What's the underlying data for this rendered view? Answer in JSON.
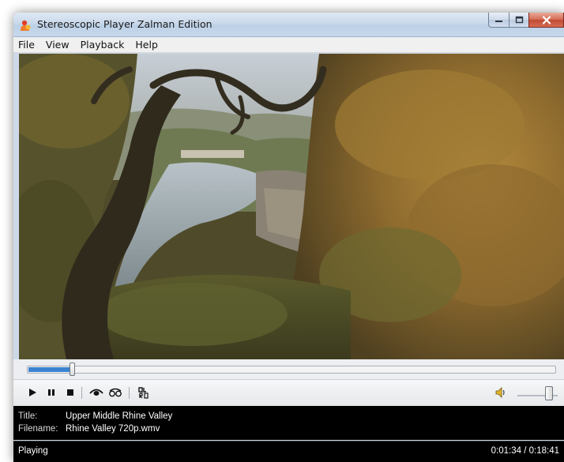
{
  "window": {
    "title": "Stereoscopic Player Zalman Edition"
  },
  "menu": [
    {
      "label": "File"
    },
    {
      "label": "View"
    },
    {
      "label": "Playback"
    },
    {
      "label": "Help"
    }
  ],
  "playback": {
    "position_fraction": 0.085,
    "volume_fraction": 0.85
  },
  "info": {
    "title_label": "Title:",
    "title_value": "Upper Middle Rhine Valley",
    "filename_label": "Filename:",
    "filename_value": "Rhine Valley 720p.wmv"
  },
  "status": {
    "state": "Playing",
    "time": "0:01:34 / 0:18:41"
  },
  "colors": {
    "accent": "#3b83d1",
    "close_button": "#c9553d"
  },
  "icons": [
    "app-icon",
    "minimize-icon",
    "maximize-icon",
    "close-icon",
    "play-icon",
    "pause-icon",
    "stop-icon",
    "anaglyph-icon",
    "glasses-icon",
    "swap-lr-icon",
    "speaker-icon"
  ]
}
